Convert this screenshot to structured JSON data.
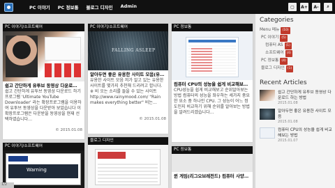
{
  "nav": {
    "items": [
      "PC 이야기",
      "PC 정보통",
      "블로그 디자인",
      "Admin"
    ]
  },
  "toolbar": {
    "font_up": "A+",
    "font_down": "A-"
  },
  "cards": [
    {
      "category": "PC 이야기/소프트웨어",
      "title": "쉽고 간단하게 유투브 동영상 다운로…",
      "body": "쉽고 간단하게 유투브 동영상 다운로드 하기 프로그램 'Ultimate YouTube Downloader' 라는 확장프로그램을 이용하여 유투브 동영상을 다운받아 보았습니다 이 확장프로그램은 다운받을 동영상을 현재 선택하였습니다…",
      "date": "© 2015.01.08"
    },
    {
      "category": "PC 이야기/소프트웨어",
      "title": "알아두면 좋은 유용한 사이트 모음(유…",
      "body": "유용한 사이트 모음 저가 알고 있는 유용한 사이트를 몇가지 추천해 드리려고 합니다. ※ 비 오는 소리를 들을 수 있는 사이트 http://www.rainymood.com/ \"Rain makes everything better\" 비는…",
      "date": "© 2015.01.08"
    },
    {
      "category": "PC 정보통",
      "title": "컴퓨터 CPU의 성능을 쉽게 비교해보…",
      "body": "CPU성능을 쉽게 비교해보고 순위알아보는 방법 컴퓨터의 성능을 좌우하는 세가지 중요한 요소 중 하나인 CPU. 그 성능이 어느 정도인지 비교하기 위해 순위를 알아보는 방법을 알려드리겠습니다…",
      "date": ""
    },
    {
      "category": "PC 이야기/소프트웨어",
      "title": "",
      "body": "",
      "date": ""
    },
    {
      "category": "블로그 디자인",
      "title": "",
      "body": "",
      "date": ""
    },
    {
      "category": "PC 정보통",
      "title": "윈 게임(리그오브레전드) 컴퓨터 사양…",
      "body": "",
      "date": ""
    }
  ],
  "sidebar": {
    "categories_heading": "Categories",
    "categories": [
      {
        "label": "Menu 메뉴",
        "count": "(10)"
      },
      {
        "label": "PC 이야기",
        "count": "(5)"
      },
      {
        "label": "컴퓨터 AS",
        "count": "(1)"
      },
      {
        "label": "소프트웨어",
        "count": "(4)"
      },
      {
        "label": "PC 정보통",
        "count": "(4)"
      },
      {
        "label": "블로그 디자인",
        "count": "(1)"
      }
    ],
    "recent_heading": "Recent Articles",
    "recent": [
      {
        "title": "쉽고 간단하게 유투브 동영상 다운로드 하는 방법",
        "date": "2015.01.08"
      },
      {
        "title": "알아두면 좋은 유용한 사이트 모음",
        "date": "2015.01.08"
      },
      {
        "title": "컴퓨터 CPU의 성능을 쉽게 비교해보는 방법",
        "date": "2015.01.07"
      }
    ]
  },
  "pager": "1/2"
}
